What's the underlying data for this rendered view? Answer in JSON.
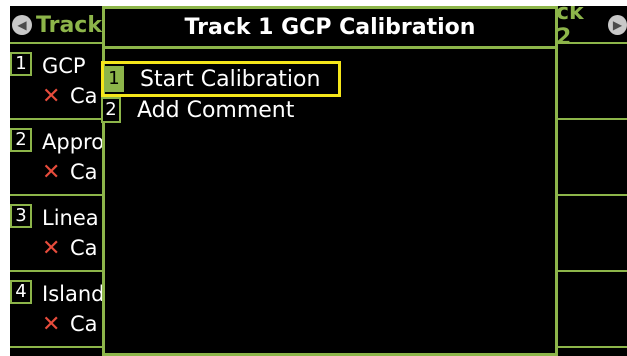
{
  "background": {
    "left_track_label": "Track",
    "right_track_label": "ck 2",
    "rows": [
      {
        "num": "1",
        "name": "GCP",
        "status": "Ca"
      },
      {
        "num": "2",
        "name": "Appro",
        "status": "Ca"
      },
      {
        "num": "3",
        "name": "Linea",
        "status": "Ca"
      },
      {
        "num": "4",
        "name": "Island",
        "status": "Ca"
      }
    ]
  },
  "popup": {
    "title": "Track 1 GCP Calibration",
    "items": [
      {
        "num": "1",
        "label": "Start Calibration"
      },
      {
        "num": "2",
        "label": "Add Comment"
      }
    ]
  },
  "colors": {
    "accent": "#8db54a",
    "highlight": "#f5e61a",
    "fail_x": "#e74c3c",
    "background": "#000000"
  },
  "icons": {
    "prev": "left-arrow-icon",
    "next": "right-arrow-icon",
    "fail": "x-mark-icon"
  }
}
